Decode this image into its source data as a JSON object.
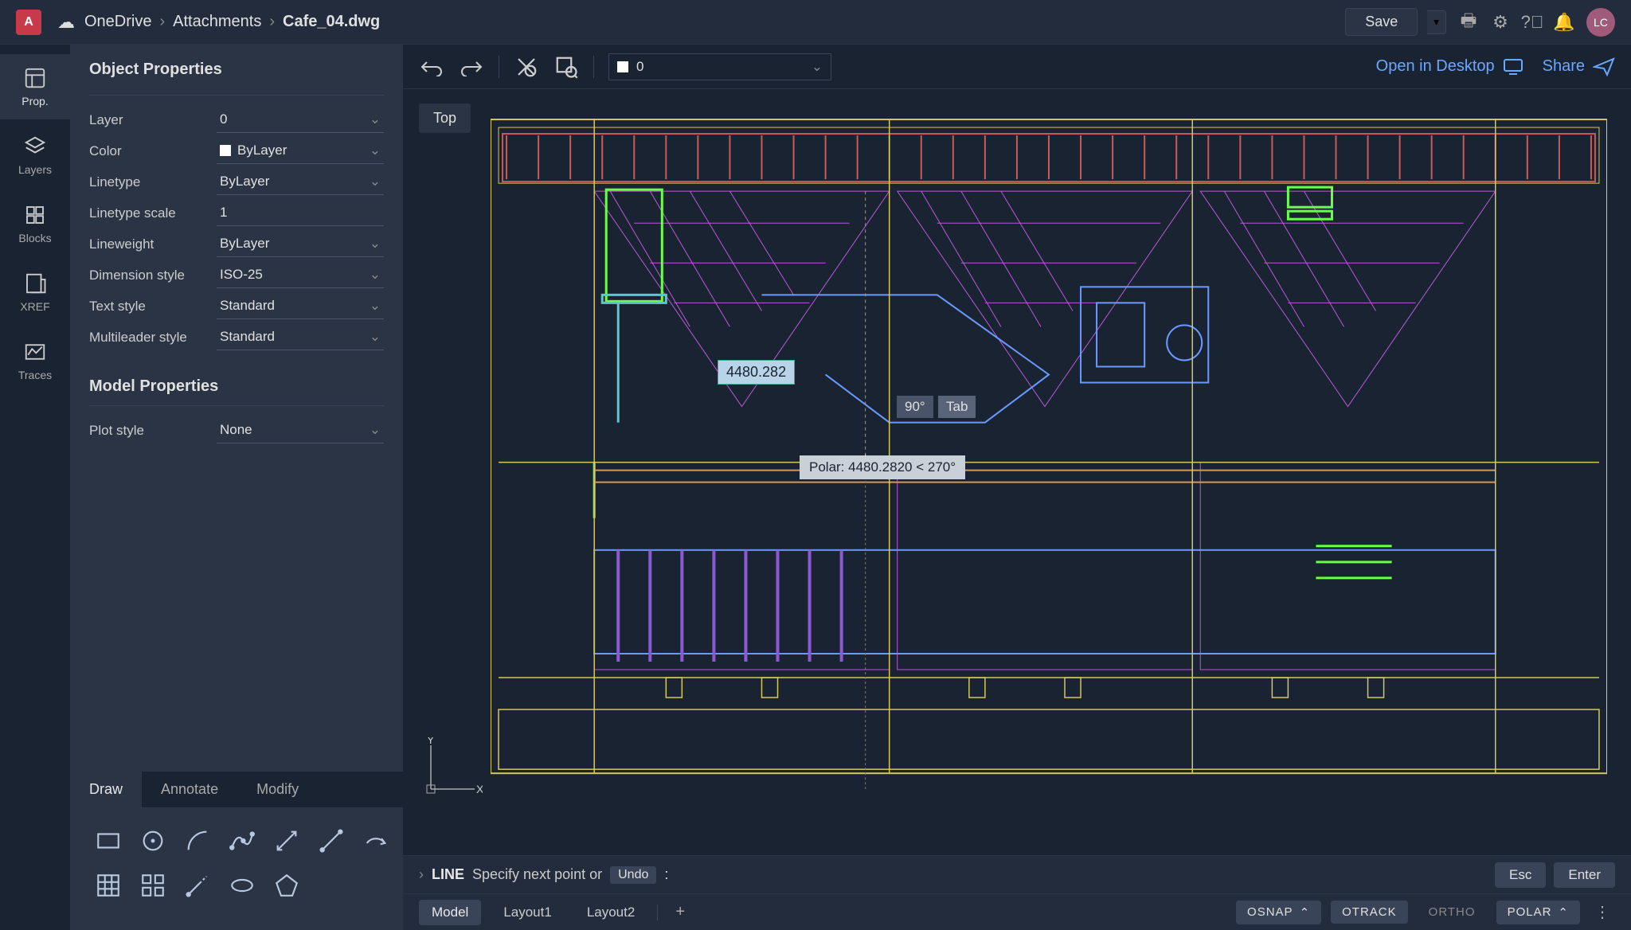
{
  "logo_letter": "A",
  "breadcrumb": [
    "OneDrive",
    "Attachments",
    "Cafe_04.dwg"
  ],
  "topbar": {
    "save": "Save",
    "avatar": "LC"
  },
  "rail": [
    {
      "label": "Prop.",
      "active": true
    },
    {
      "label": "Layers",
      "active": false
    },
    {
      "label": "Blocks",
      "active": false
    },
    {
      "label": "XREF",
      "active": false
    },
    {
      "label": "Traces",
      "active": false
    }
  ],
  "object_properties_title": "Object Properties",
  "properties": {
    "layer": {
      "label": "Layer",
      "value": "0"
    },
    "color": {
      "label": "Color",
      "value": "ByLayer"
    },
    "linetype": {
      "label": "Linetype",
      "value": "ByLayer"
    },
    "linetype_scale": {
      "label": "Linetype scale",
      "value": "1"
    },
    "lineweight": {
      "label": "Lineweight",
      "value": "ByLayer"
    },
    "dimension_style": {
      "label": "Dimension style",
      "value": "ISO-25"
    },
    "text_style": {
      "label": "Text style",
      "value": "Standard"
    },
    "multileader_style": {
      "label": "Multileader style",
      "value": "Standard"
    }
  },
  "model_properties_title": "Model Properties",
  "model_properties": {
    "plot_style": {
      "label": "Plot style",
      "value": "None"
    }
  },
  "tool_tabs": [
    "Draw",
    "Annotate",
    "Modify"
  ],
  "canvas_toolbar": {
    "layer_dd": "0",
    "open_desktop": "Open in Desktop",
    "share": "Share"
  },
  "view_badge": "Top",
  "dim_value": "4480.282",
  "angle_value": "90°",
  "tab_hint": "Tab",
  "polar_tip": "Polar: 4480.2820 < 270°",
  "ucs": {
    "x": "X",
    "y": "Y"
  },
  "command": {
    "name": "LINE",
    "prompt": "Specify next point or",
    "undo": "Undo",
    "esc": "Esc",
    "enter": "Enter"
  },
  "layouts": [
    "Model",
    "Layout1",
    "Layout2"
  ],
  "status_toggles": [
    {
      "label": "OSNAP",
      "on": true,
      "chev": true
    },
    {
      "label": "OTRACK",
      "on": true,
      "chev": false
    },
    {
      "label": "ORTHO",
      "on": false,
      "chev": false
    },
    {
      "label": "POLAR",
      "on": true,
      "chev": true
    }
  ]
}
